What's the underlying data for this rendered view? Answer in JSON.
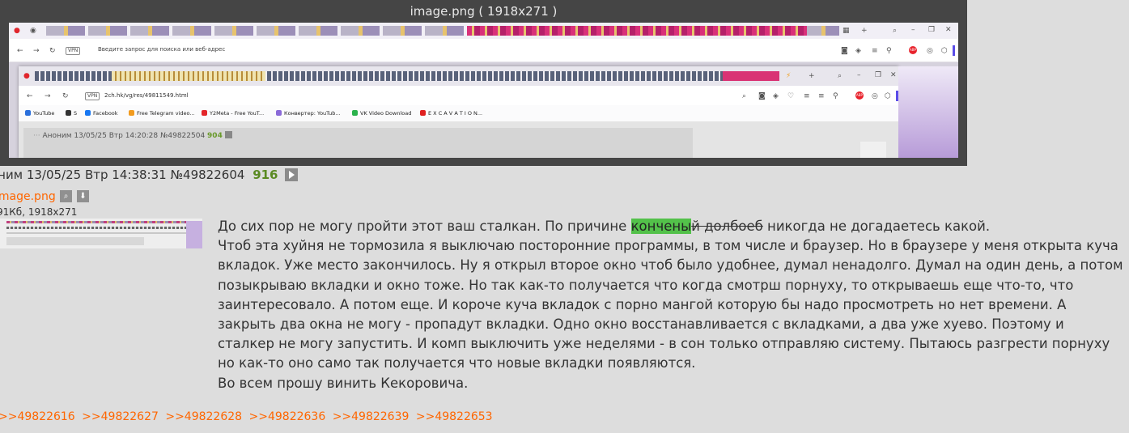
{
  "preview": {
    "title": "image.png ( 1918x271 )",
    "address_placeholder": "Введите запрос для поиска или веб-адрес",
    "vpn_label": "VPN",
    "inner": {
      "url": "2ch.hk/vg/res/49811549.html",
      "vpn_label": "VPN",
      "bookmarks": [
        "YouTube",
        "S",
        "Facebook",
        "Free Telegram video...",
        "Y2Meta - Free YouT...",
        "Конвертер: YouTub...",
        "VK Video Download",
        "E X C A V A T I O N..."
      ],
      "bookmark_icon_colors": [
        "#2a6fdb",
        "#333333",
        "#1877f2",
        "#f29b1f",
        "#e3262a",
        "#8a6ad8",
        "#2bb24c",
        "#e02020"
      ],
      "post_header": {
        "author": "Аноним",
        "date": "13/05/25 Втр 14:20:28",
        "number": "№49822504",
        "count": "904"
      }
    }
  },
  "post": {
    "author": "оним",
    "date": "13/05/25 Втр 14:38:31",
    "number": "№49822604",
    "count": "916",
    "file": {
      "name": "image.png",
      "meta": "91Кб, 1918x271"
    },
    "body": {
      "line1_before": "До сих пор не могу пройти этот ваш сталкан. По причине ",
      "line1_highlight": "кончены",
      "line1_strike": "й долбоеб",
      "line1_after": " никогда не догадаетесь какой.",
      "paragraph2": "Чтоб эта хуйня не тормозила я выключаю посторонние программы, в том числе и браузер. Но в браузере у меня открыта куча вкладок. Уже место закончилось. Ну я открыл второе окно чтоб было удобнее, думал ненадолго. Думал на один день, а потом позыкрываю вкладки и окно тоже. Но так как-то получается что когда смотрш порнуху, то открываешь еще что-то, что заинтересовало. А потом еще. И короче куча вкладок с порно мангой которую бы надо просмотреть но нет времени. А закрыть два окна не могу - пропадут вкладки. Одно окно восстанавливается с вкладками, а два уже хуево. Поэтому и сталкер не могу запустить. И комп выключить уже неделями - в сон только отправляю систему. Пытаюсь разгрести порнуху но как-то оно само так получается что новые вкладки появляются.",
      "line_last": "Во всем прошу винить Кекоровича."
    },
    "replies": [
      ">>49822616",
      ">>49822627",
      ">>49822628",
      ">>49822636",
      ">>49822639",
      ">>49822653"
    ]
  },
  "colors": {
    "background": "#dddddd",
    "link": "#ff6600",
    "post_count": "#5a8a22",
    "highlight": "#53c14a"
  }
}
